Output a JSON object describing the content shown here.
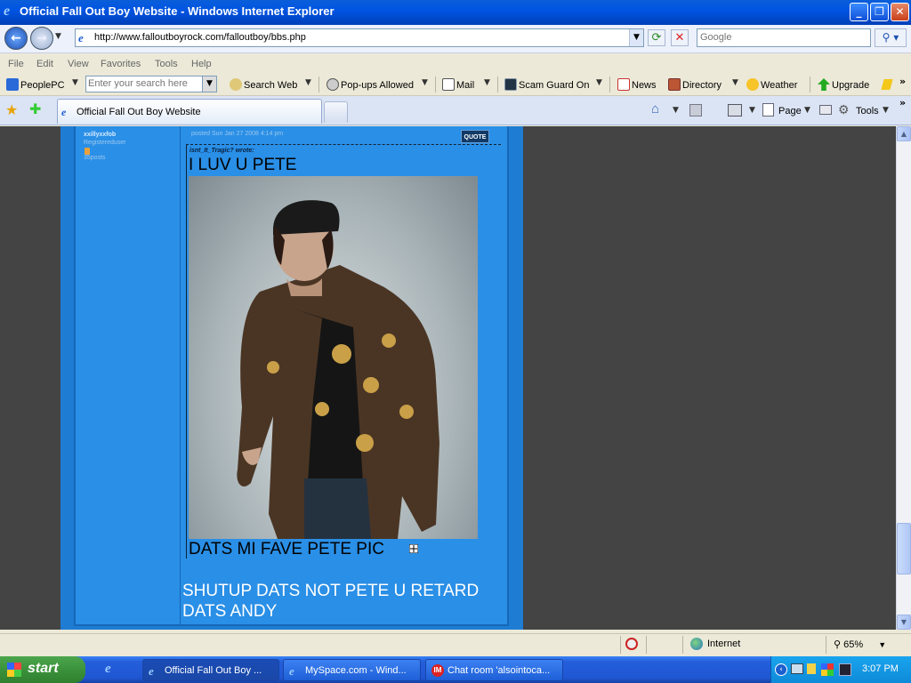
{
  "window": {
    "title": "Official Fall Out Boy Website - Windows Internet Explorer"
  },
  "address_bar": {
    "url": "http://www.falloutboyrock.com/falloutboy/bbs.php"
  },
  "search_box": {
    "placeholder": "Google"
  },
  "menu": [
    "File",
    "Edit",
    "View",
    "Favorites",
    "Tools",
    "Help"
  ],
  "peoplepc_toolbar": {
    "brand": "PeoplePC",
    "search_placeholder": "Enter your search here",
    "search_web": "Search Web",
    "popups": "Pop-ups Allowed",
    "mail": "Mail",
    "scam_guard": "Scam Guard On",
    "news": "News",
    "directory": "Directory",
    "weather": "Weather",
    "upgrade": "Upgrade"
  },
  "tabs": [
    {
      "label": "Official Fall Out Boy Website"
    }
  ],
  "command_bar": {
    "page": "Page",
    "tools": "Tools"
  },
  "post": {
    "username": "xxillyxxfob",
    "rank": "Registereduser",
    "post_count": "35posts",
    "posted": "posted Sun Jan 27 2008 4:14 pm",
    "quote_button": "QUOTE",
    "quote_author": "isnt_It_Tragic? wrote:",
    "quote_headline": "I LUV U PETE",
    "quote_caption": "DATS MI FAVE PETE PIC",
    "reply": "SHUTUP DATS NOT PETE U RETARD DATS ANDY"
  },
  "status_bar": {
    "zone": "Internet",
    "zoom": "65%"
  },
  "taskbar": {
    "start": "start",
    "tasks": [
      {
        "label": "Official Fall Out Boy ..."
      },
      {
        "label": "MySpace.com - Wind..."
      },
      {
        "label": "Chat room 'alsointoca..."
      }
    ],
    "clock": "3:07 PM"
  }
}
